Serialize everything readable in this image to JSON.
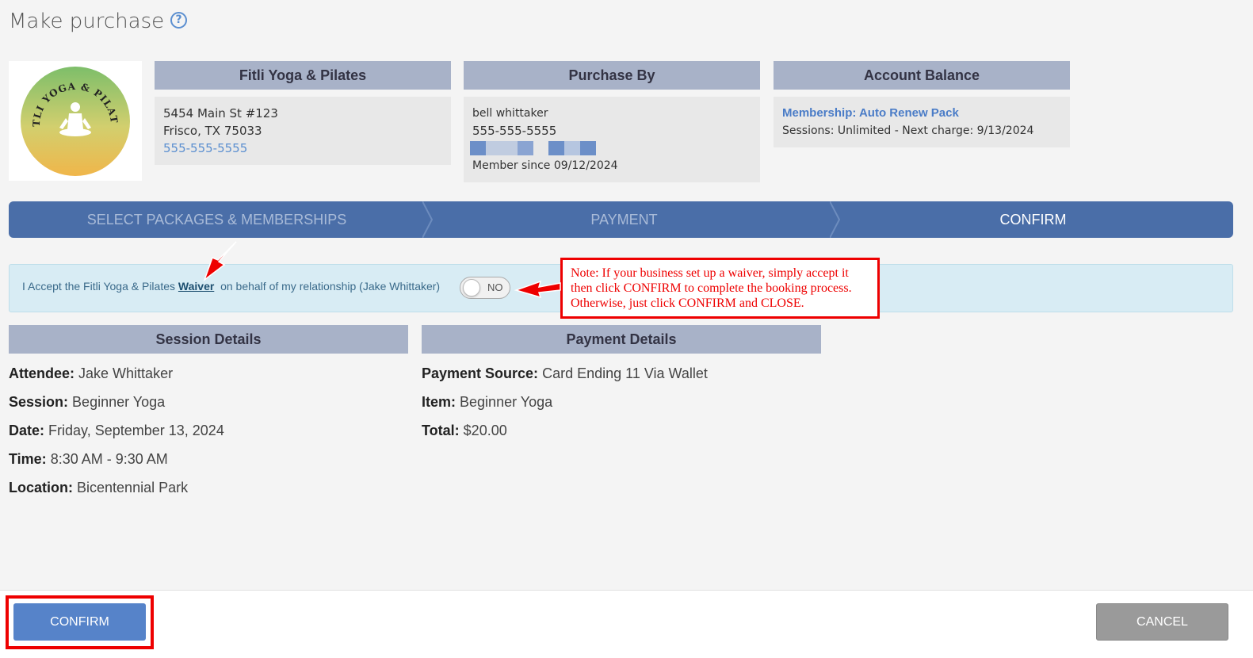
{
  "header": {
    "title": "Make purchase",
    "help_glyph": "?"
  },
  "logo": {
    "alt": "FITLI YOGA & PILATES",
    "top_text": "FITLI YOGA & PILATES"
  },
  "business": {
    "heading": "Fitli Yoga & Pilates",
    "address1": "5454 Main St #123",
    "address2": "Frisco, TX 75033",
    "phone": "555-555-5555"
  },
  "purchaser": {
    "heading": "Purchase By",
    "name": "bell whittaker",
    "phone": "555-555-5555",
    "member_since": "Member since 09/12/2024"
  },
  "account": {
    "heading": "Account Balance",
    "membership": "Membership: Auto Renew Pack",
    "sessions": "Sessions: Unlimited -  Next charge: 9/13/2024"
  },
  "steps": [
    {
      "label": "SELECT PACKAGES & MEMBERSHIPS",
      "state": "inactive"
    },
    {
      "label": "PAYMENT",
      "state": "inactive"
    },
    {
      "label": "CONFIRM",
      "state": "active"
    }
  ],
  "waiver": {
    "prefix": "I Accept the Fitli Yoga & Pilates",
    "link": "Waiver",
    "suffix": "on behalf of my relationship (Jake Whittaker)",
    "toggle_label": "NO",
    "toggle_on": false
  },
  "note": "Note: If your business set up a waiver, simply accept it then click CONFIRM to complete the booking process. Otherwise, just click CONFIRM and CLOSE.",
  "session_details": {
    "heading": "Session Details",
    "attendee_label": "Attendee:",
    "attendee": "Jake Whittaker",
    "session_label": "Session:",
    "session": "Beginner Yoga",
    "date_label": "Date:",
    "date": "Friday, September 13, 2024",
    "time_label": "Time:",
    "time": "8:30 AM - 9:30 AM",
    "location_label": "Location:",
    "location": "Bicentennial Park"
  },
  "payment_details": {
    "heading": "Payment Details",
    "source_label": "Payment Source:",
    "source": "Card Ending 11 Via Wallet",
    "item_label": "Item:",
    "item": "Beginner Yoga",
    "total_label": "Total:",
    "total": "$20.00"
  },
  "footer": {
    "confirm_label": "CONFIRM",
    "cancel_label": "CANCEL"
  },
  "colors": {
    "accent": "#4a6ea8",
    "annotation": "#ee0000",
    "header_bg": "#a8b2c8"
  }
}
